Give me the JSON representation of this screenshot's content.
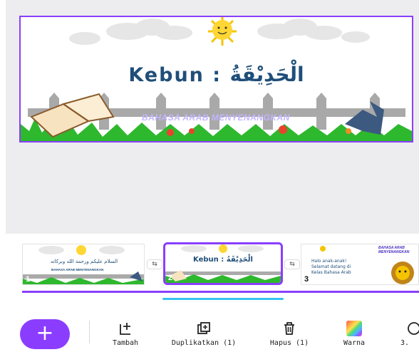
{
  "slide_main": {
    "title_latin": "Kebun : ",
    "title_arabic": "الْحَدِيْقَةُ",
    "banner": "BAHASA ARAB MENYENANGKAN"
  },
  "thumbnails": [
    {
      "number": "1",
      "arabic": "السلام عليكم ورحمة الله وبركاته",
      "banner": "BAHASA ARAB MENYENANGKAN"
    },
    {
      "number": "2",
      "title_latin": "Kebun : ",
      "title_arabic": "الْحَدِيْقَةُ"
    },
    {
      "number": "3",
      "text": "Halo anak-anak! Selamat datang di Kelas Bahasa Arab",
      "banner": "BAHASA ARAB MENYENANGKAN"
    }
  ],
  "toolbar": {
    "add_label": "+",
    "items": [
      {
        "label": "Tambah",
        "icon": "add-page-icon"
      },
      {
        "label": "Duplikatkan (1)",
        "icon": "duplicate-icon"
      },
      {
        "label": "Hapus (1)",
        "icon": "trash-icon"
      },
      {
        "label": "Warna",
        "icon": "color-swatch-icon"
      },
      {
        "label": "3.",
        "icon": "more-icon"
      }
    ]
  },
  "colors": {
    "accent": "#8b3dff",
    "title_text": "#1f4e79",
    "banner_text": "#c3b5ff",
    "scroll": "#37c2f0"
  }
}
